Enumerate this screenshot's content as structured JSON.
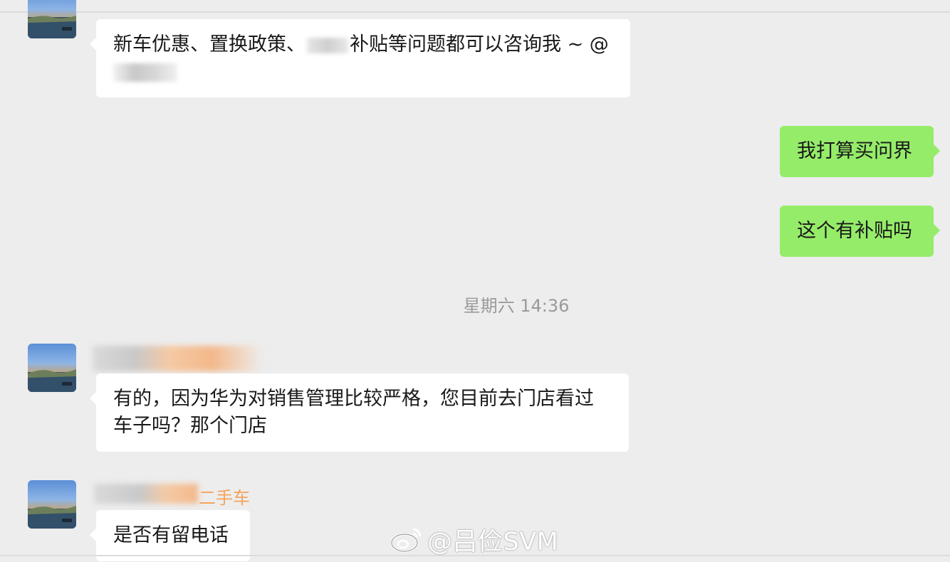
{
  "messages": {
    "msg1": {
      "text_before": "新车优惠、置换政策、",
      "text_after": "补贴等问题都可以咨询我 ~ @"
    },
    "msg2": {
      "text": "我打算买问界"
    },
    "msg3": {
      "text": "这个有补贴吗"
    },
    "msg4": {
      "text_line1": "有的，因为华为对销售管理比较严格，您目前去门店看过",
      "text_line2": "车子吗？那个门店"
    },
    "msg5": {
      "text": "是否有留电话"
    }
  },
  "timestamp": "星期六 14:36",
  "sender": {
    "nickname_suffix": "二手车"
  },
  "watermark": {
    "text": "@吕俭SVM"
  },
  "colors": {
    "background": "#ededed",
    "incoming_bubble": "#ffffff",
    "outgoing_bubble": "#95ec69",
    "nickname": "#f7a35c",
    "timestamp": "#9a9a9a"
  },
  "icons": {
    "watermark_logo": "weibo-icon"
  }
}
